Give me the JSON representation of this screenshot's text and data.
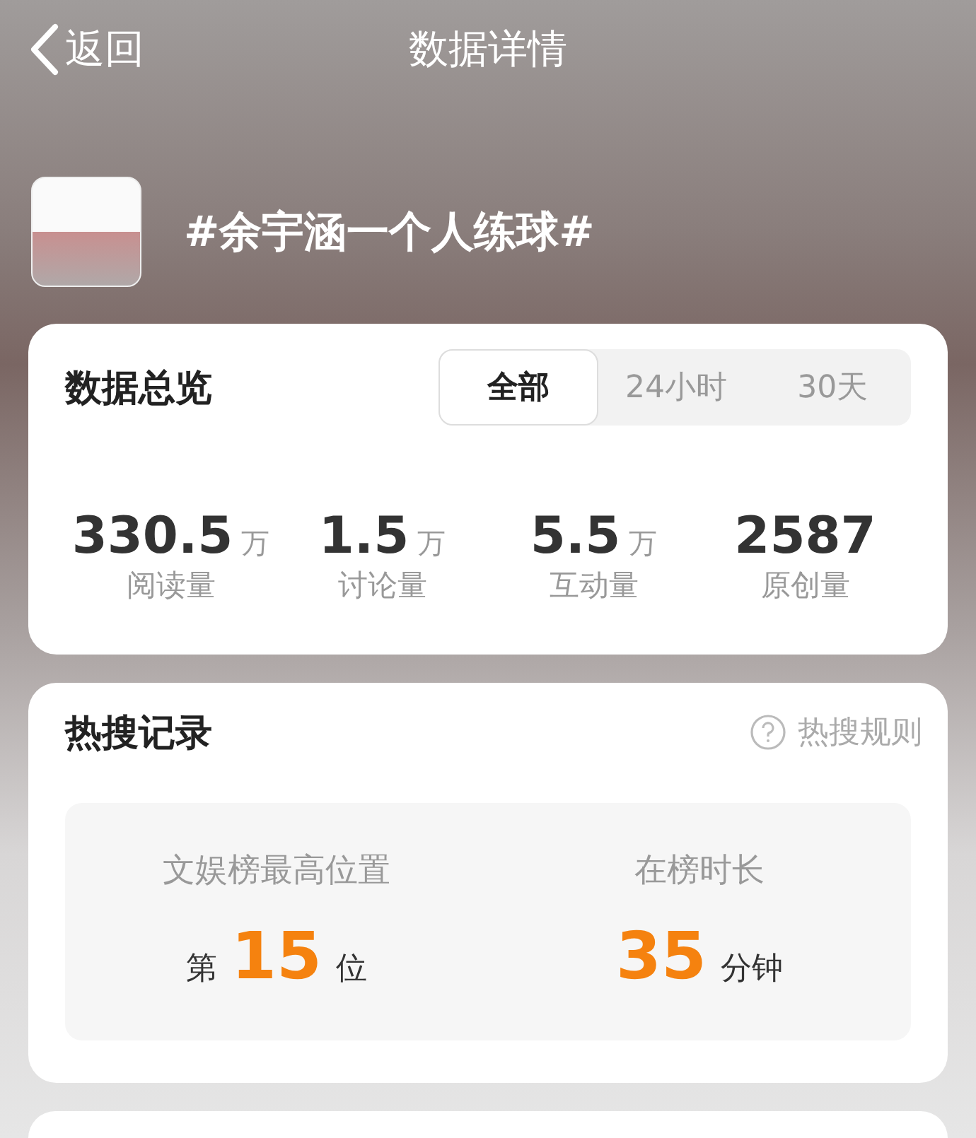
{
  "nav": {
    "back": "返回",
    "title": "数据详情"
  },
  "topic": {
    "title": "#余宇涵一个人练球#"
  },
  "overview": {
    "title": "数据总览",
    "tabs": [
      {
        "label": "全部",
        "selected": true
      },
      {
        "label": "24小时",
        "selected": false
      },
      {
        "label": "30天",
        "selected": false
      }
    ],
    "stats": [
      {
        "value": "330.5",
        "unit": "万",
        "label": "阅读量"
      },
      {
        "value": "1.5",
        "unit": "万",
        "label": "讨论量"
      },
      {
        "value": "5.5",
        "unit": "万",
        "label": "互动量"
      },
      {
        "value": "2587",
        "label": "原创量"
      }
    ]
  },
  "hot_search": {
    "title": "热搜记录",
    "rules_link": "热搜规则",
    "records": [
      {
        "label": "文娱榜最高位置",
        "prefix": "第",
        "value": "15",
        "suffix": "位"
      },
      {
        "label": "在榜时长",
        "value": "35",
        "suffix": "分钟"
      }
    ]
  }
}
